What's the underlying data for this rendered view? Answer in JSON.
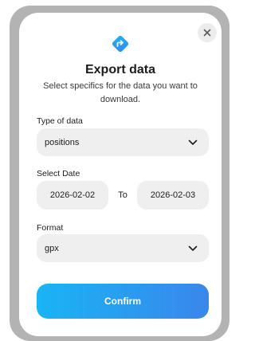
{
  "dialog": {
    "title": "Export data",
    "subtitle": "Select specifics for the data you want to download.",
    "close_icon": "close-icon",
    "logo_icon": "directions-diamond-icon",
    "accent_color": "#3a86ec"
  },
  "fields": {
    "type_label": "Type of data",
    "type_value": "positions",
    "date_label": "Select Date",
    "date_from": "2026-02-02",
    "date_to_label": "To",
    "date_to": "2026-02-03",
    "format_label": "Format",
    "format_value": "gpx"
  },
  "actions": {
    "confirm_label": "Confirm"
  }
}
